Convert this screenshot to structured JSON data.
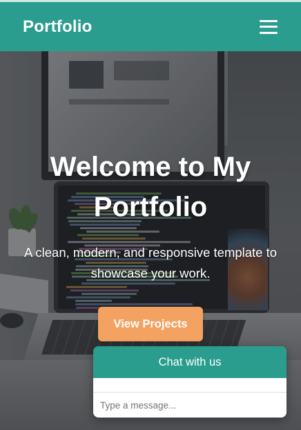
{
  "header": {
    "brand": "Portfolio",
    "menu_icon": "hamburger-menu-icon",
    "background_color": "#2a9d8f"
  },
  "hero": {
    "title": "Welcome to My Portfolio",
    "subtitle": "A clean, modern, and responsive template to showcase your work.",
    "cta_label": "View Projects",
    "cta_color": "#f4a261",
    "background_image": "laptop-on-desk-photo"
  },
  "chat": {
    "title": "Chat with us",
    "input_placeholder": "Type a message...",
    "header_color": "#2a9d8f"
  }
}
